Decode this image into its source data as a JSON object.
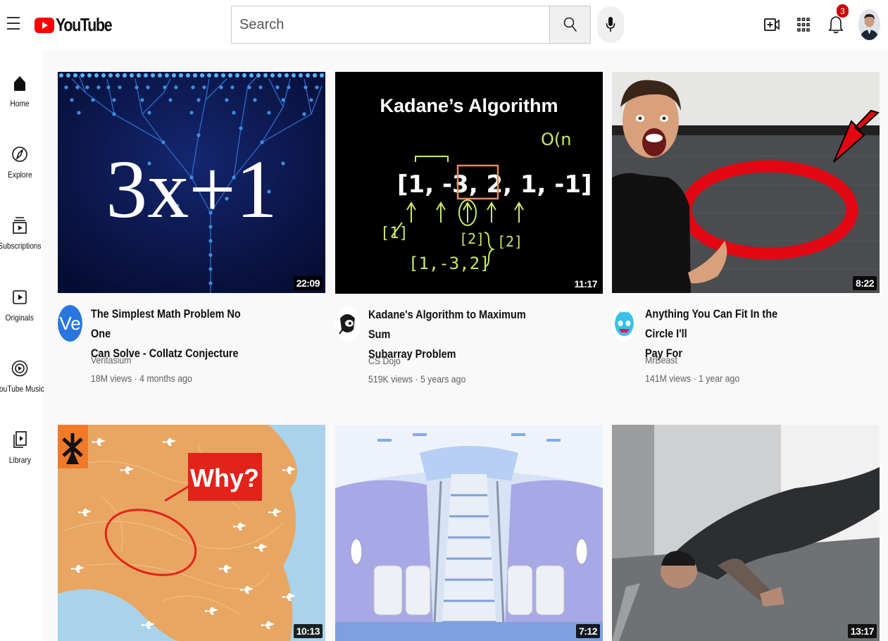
{
  "header": {
    "logo_text": "YouTube",
    "search_placeholder": "Search",
    "notification_count": "3"
  },
  "sidebar": {
    "items": [
      {
        "label": "Home",
        "icon": "home-icon"
      },
      {
        "label": "Explore",
        "icon": "compass-icon"
      },
      {
        "label": "Subscriptions",
        "icon": "subscriptions-icon"
      },
      {
        "label": "Originals",
        "icon": "originals-icon"
      },
      {
        "label": "YouTube Music",
        "icon": "music-icon"
      },
      {
        "label": "Library",
        "icon": "library-icon"
      }
    ]
  },
  "videos": [
    {
      "title_line1": "The Simplest Math Problem No One",
      "title_line2": "Can Solve - Collatz Conjecture",
      "channel": "Veritasium",
      "meta": "18M views · 4 months ago",
      "duration": "22:09",
      "thumb_text": "3x+1"
    },
    {
      "title_line1": "Kadane's Algorithm to Maximum Sum",
      "title_line2": "Subarray Problem",
      "channel": "CS Dojo",
      "meta": "519K views · 5 years ago",
      "duration": "11:17",
      "thumb_title": "Kadane’s Algorithm",
      "thumb_array": "[1, -3, 2, 1, -1]",
      "thumb_bracket1": "[1]",
      "thumb_bracket2": "[2]",
      "thumb_bracket3": "[2]",
      "thumb_sub": "[1,-3,2]",
      "thumb_on": "O(n"
    },
    {
      "title_line1": "Anything You Can Fit In the Circle I'll",
      "title_line2": "Pay For",
      "channel": "MrBeast",
      "meta": "141M views · 1 year ago",
      "duration": "8:22"
    },
    {
      "duration": "10:13",
      "thumb_text": "Why?"
    },
    {
      "duration": "7:12"
    },
    {
      "duration": "13:17"
    }
  ],
  "colors": {
    "brand_red": "#ff0000",
    "badge_red": "#cc0000",
    "meta_gray": "#606060"
  }
}
